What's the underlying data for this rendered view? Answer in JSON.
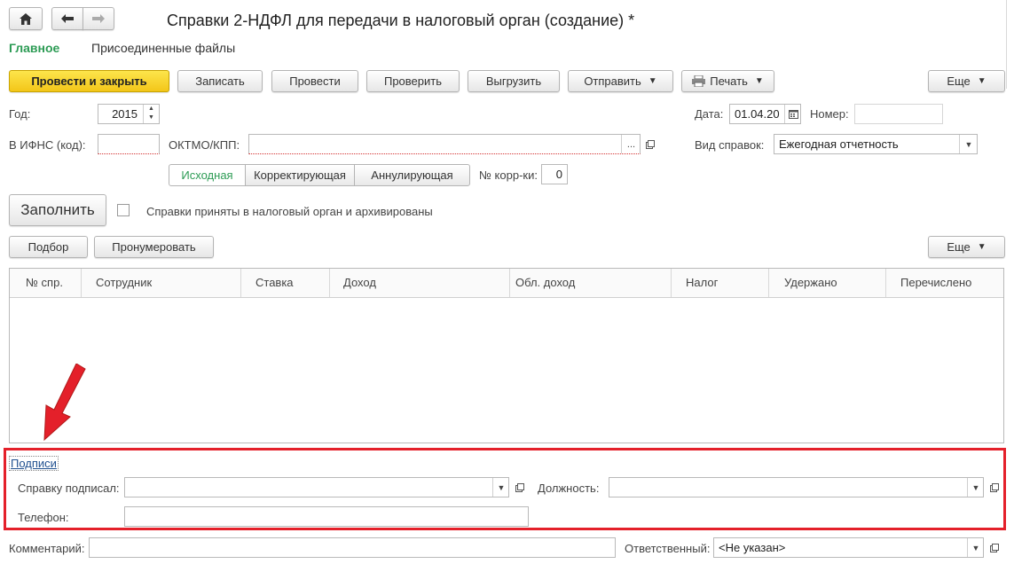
{
  "window": {
    "title": "Справки 2-НДФЛ для передачи в налоговый орган (создание) *"
  },
  "nav": {
    "main_tab": "Главное",
    "files_tab": "Присоединенные файлы"
  },
  "toolbar": {
    "post_close": "Провести и закрыть",
    "save": "Записать",
    "post": "Провести",
    "check": "Проверить",
    "export": "Выгрузить",
    "send": "Отправить",
    "print": "Печать",
    "more": "Еще"
  },
  "form": {
    "year_label": "Год:",
    "year_value": "2015",
    "date_label": "Дата:",
    "date_value": "01.04.20",
    "number_label": "Номер:",
    "number_value": "",
    "ifns_label": "В ИФНС (код):",
    "ifns_value": "",
    "oktmo_label": "ОКТМО/КПП:",
    "oktmo_value": "",
    "oktmo_dots": "...",
    "type_label": "Вид справок:",
    "type_value": "Ежегодная отчетность",
    "kind_options": [
      "Исходная",
      "Корректирующая",
      "Аннулирующая"
    ],
    "kind_selected": "Исходная",
    "corr_label": "№ корр-ки:",
    "corr_value": "0",
    "fill_button": "Заполнить",
    "archived_label": "Справки приняты в налоговый орган и архивированы",
    "archived_checked": false
  },
  "table_toolbar": {
    "select": "Подбор",
    "renumber": "Пронумеровать",
    "more": "Еще"
  },
  "table": {
    "columns": [
      "№ спр.",
      "Сотрудник",
      "Ставка",
      "Доход",
      "Обл. доход",
      "Налог",
      "Удержано",
      "Перечислено"
    ],
    "rows": []
  },
  "signatures": {
    "link": "Подписи",
    "signed_by_label": "Справку подписал:",
    "signed_by_value": "",
    "position_label": "Должность:",
    "position_value": "",
    "phone_label": "Телефон:",
    "phone_value": ""
  },
  "footer": {
    "comment_label": "Комментарий:",
    "comment_value": "",
    "responsible_label": "Ответственный:",
    "responsible_value": "<Не указан>"
  },
  "colors": {
    "accent_green": "#2c9b54",
    "primary_yellow": "#f8d52d",
    "highlight_red": "#e4202a",
    "link_blue": "#1f4f8f"
  }
}
